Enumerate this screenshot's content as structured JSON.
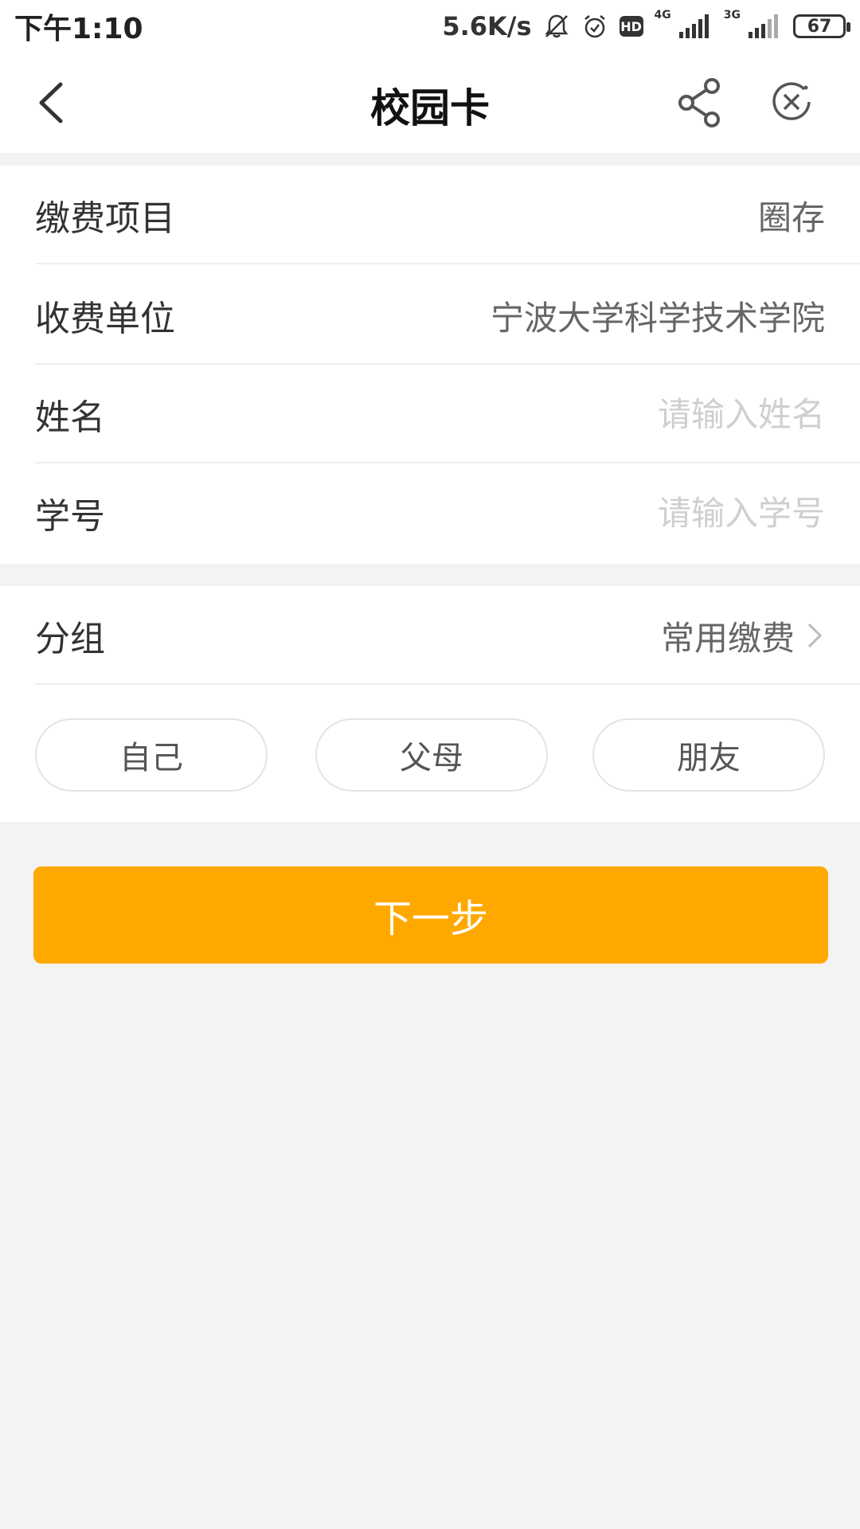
{
  "status_bar": {
    "time": "下午1:10",
    "net_speed": "5.6K/s",
    "hd": "HD",
    "net1": "4G",
    "net2": "3G",
    "battery": "67"
  },
  "nav": {
    "title": "校园卡"
  },
  "form": {
    "rows": [
      {
        "label": "缴费项目",
        "value": "圈存"
      },
      {
        "label": "收费单位",
        "value": "宁波大学科学技术学院"
      },
      {
        "label": "姓名",
        "placeholder": "请输入姓名",
        "value": ""
      },
      {
        "label": "学号",
        "placeholder": "请输入学号",
        "value": ""
      }
    ]
  },
  "group": {
    "label": "分组",
    "value": "常用缴费",
    "chips": [
      "自己",
      "父母",
      "朋友"
    ]
  },
  "next_button": "下一步",
  "colors": {
    "accent": "#ffa800",
    "background": "#f3f3f3",
    "placeholder": "#cfcfcf"
  }
}
